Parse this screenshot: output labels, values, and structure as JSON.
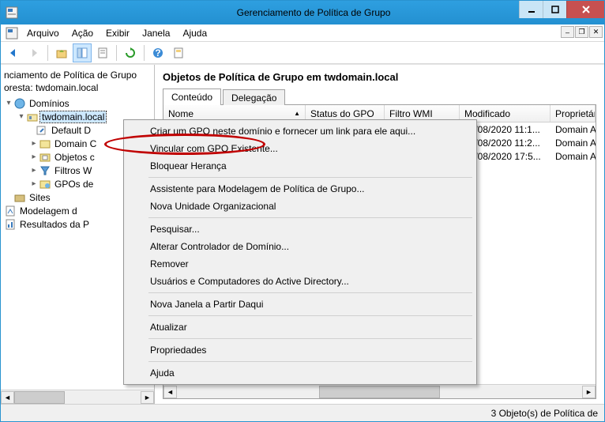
{
  "window": {
    "title": "Gerenciamento de Política de Grupo"
  },
  "menu": {
    "items": [
      "Arquivo",
      "Ação",
      "Exibir",
      "Janela",
      "Ajuda"
    ]
  },
  "tree": {
    "heading": "nciamento de Política de Grupo",
    "forest": "oresta: twdomain.local",
    "nodes": {
      "dominios": "Domínios",
      "domain": "twdomain.local",
      "defaultd": "Default D",
      "domainc": "Domain C",
      "objetosc": "Objetos c",
      "filtrosw": "Filtros W",
      "gposde": "GPOs de",
      "sites": "Sites",
      "modelagem": "Modelagem d",
      "resultados": "Resultados da P"
    }
  },
  "right": {
    "title": "Objetos de Política de Grupo em twdomain.local",
    "tabs": {
      "conteudo": "Conteúdo",
      "delegacao": "Delegação"
    },
    "columns": {
      "nome": "Nome",
      "status": "Status do GPO",
      "filtro": "Filtro WMI",
      "modificado": "Modificado",
      "proprietario": "Proprietário"
    },
    "rows": [
      {
        "modificado": "18/08/2020 11:1...",
        "proprietario": "Domain Adr"
      },
      {
        "modificado": "18/08/2020 11:2...",
        "proprietario": "Domain Adr"
      },
      {
        "modificado": "20/08/2020 17:5...",
        "proprietario": "Domain Adr"
      }
    ]
  },
  "status": {
    "text": "3 Objeto(s) de Política de"
  },
  "context": {
    "items": [
      "Criar um GPO neste domínio e fornecer um link para ele aqui...",
      "Vincular com GPO Existente...",
      "Bloquear Herança",
      "-",
      "Assistente para Modelagem de Política de Grupo...",
      "Nova Unidade Organizacional",
      "-",
      "Pesquisar...",
      "Alterar Controlador de Domínio...",
      "Remover",
      "Usuários e Computadores do Active Directory...",
      "-",
      "Nova Janela a Partir Daqui",
      "-",
      "Atualizar",
      "-",
      "Propriedades",
      "-",
      "Ajuda"
    ]
  }
}
